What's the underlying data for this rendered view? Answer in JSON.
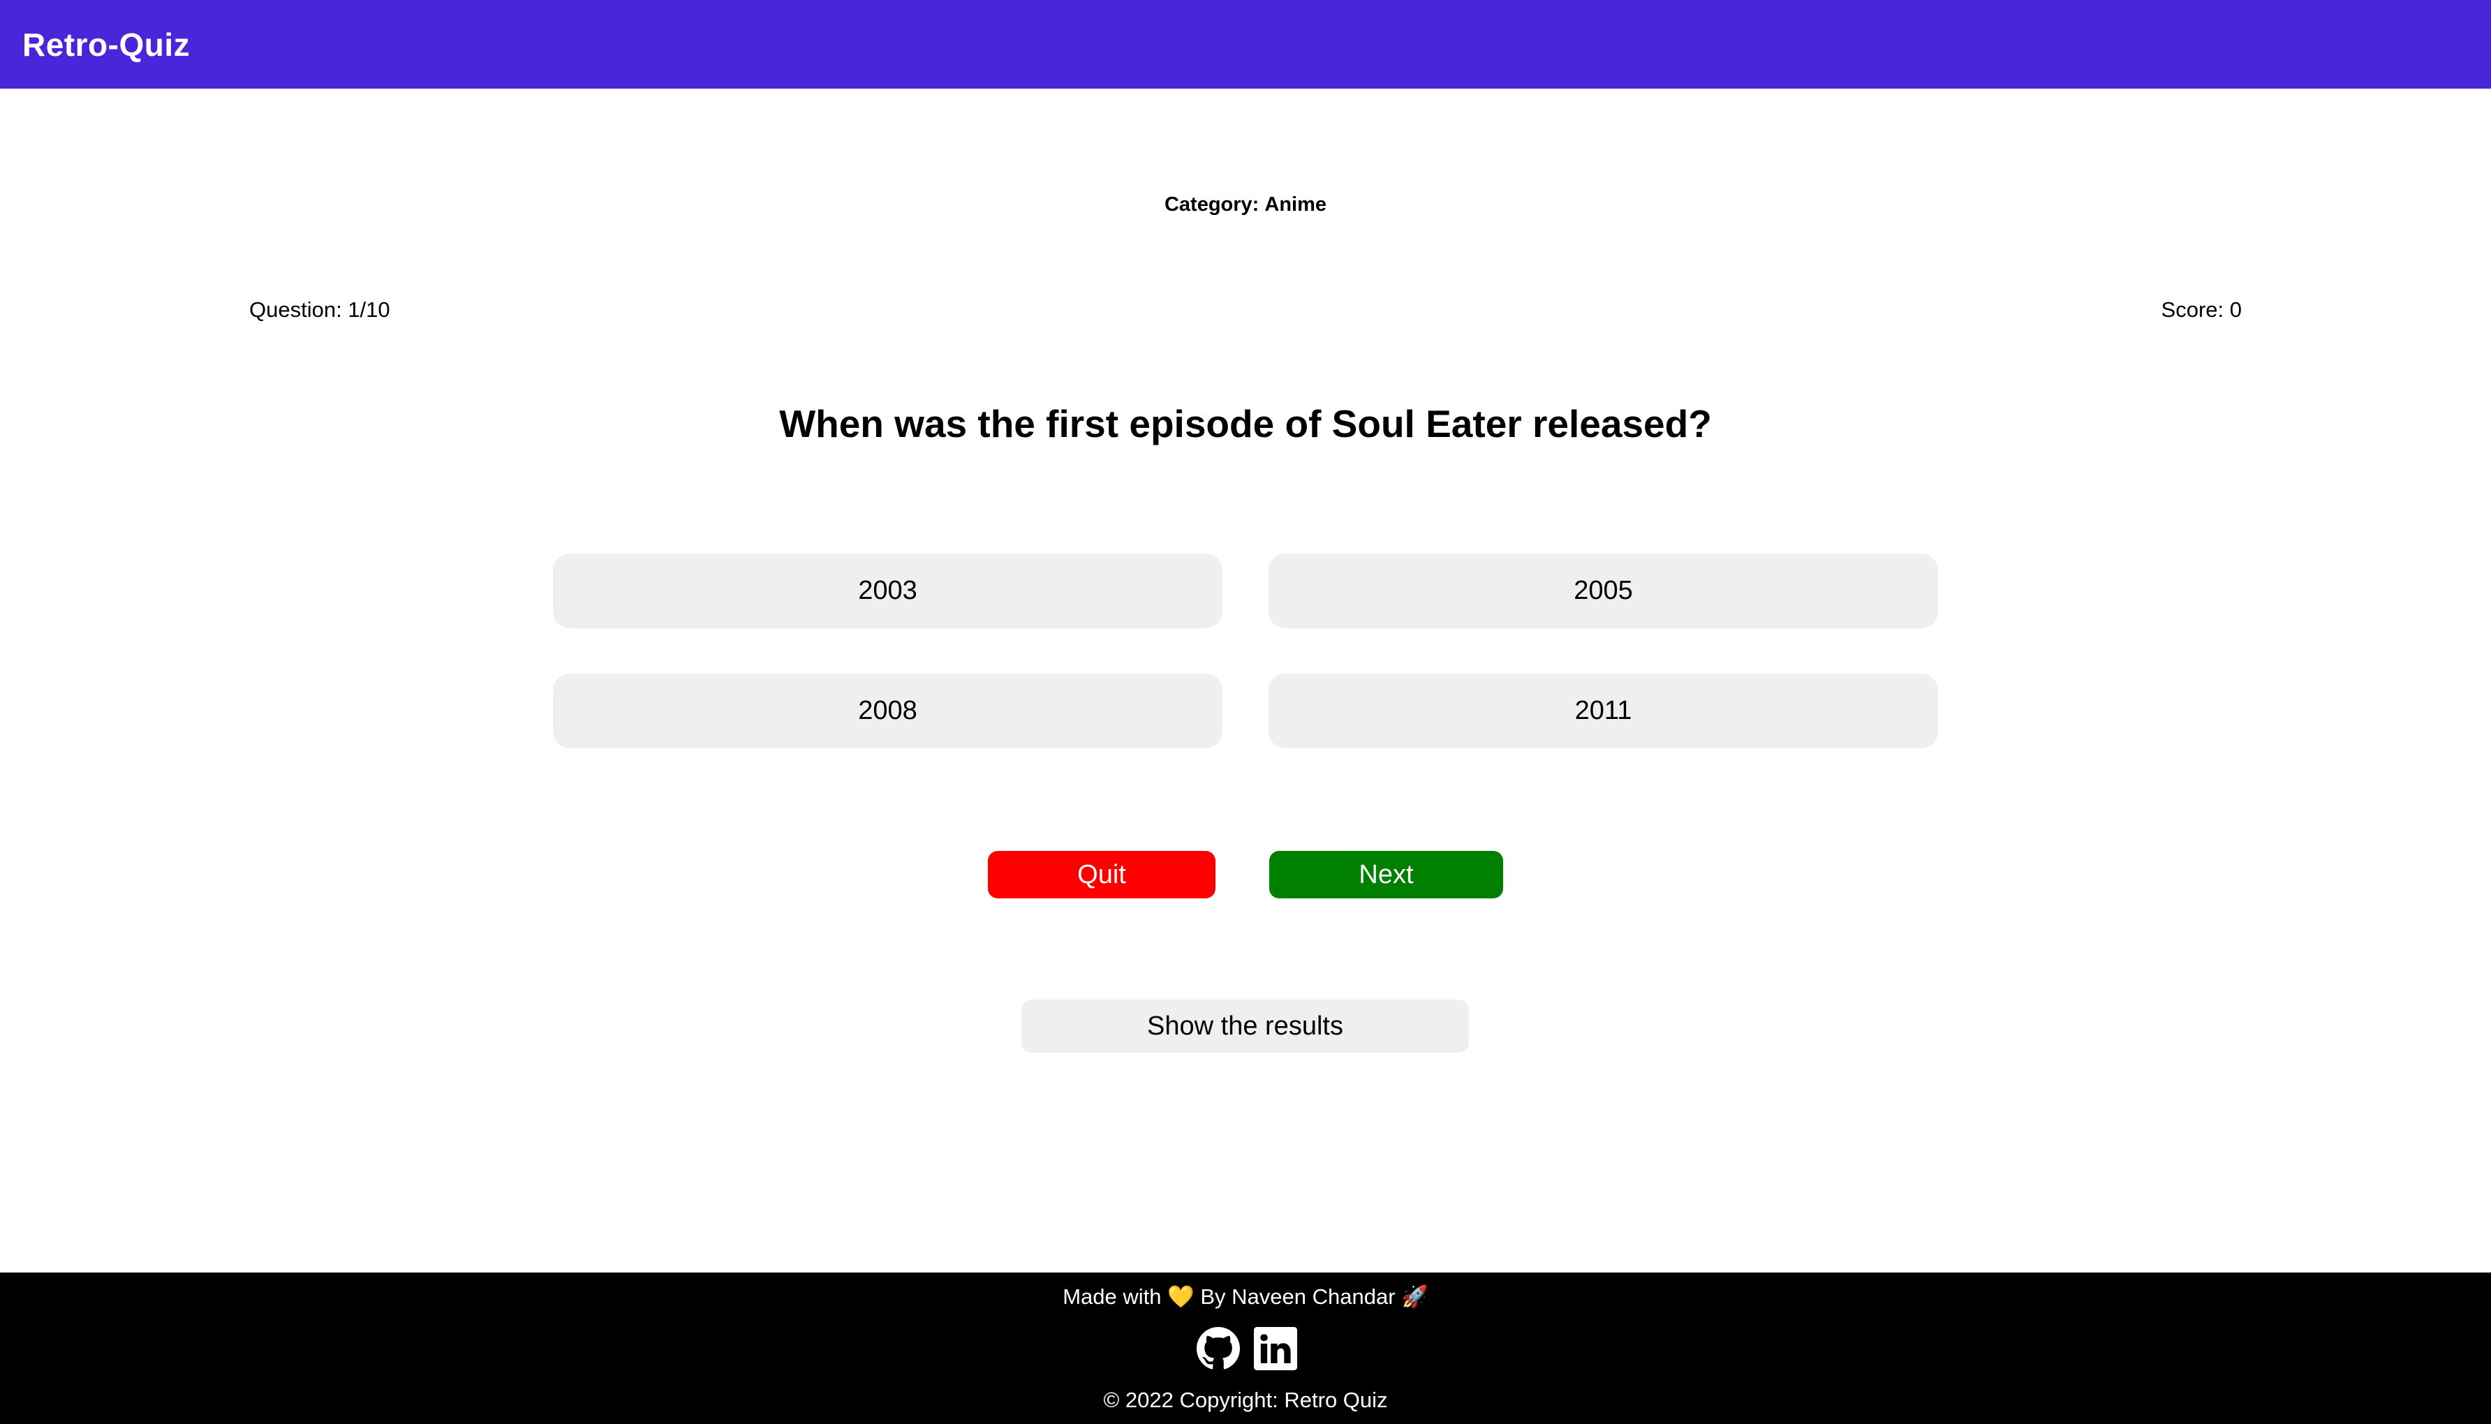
{
  "header": {
    "brand": "Retro-Quiz"
  },
  "quiz": {
    "category_label": "Category:",
    "category_value": "Anime",
    "question_counter": "Question: 1/10",
    "score": "Score: 0",
    "question": "When was the first episode of Soul Eater released?",
    "options": [
      "2003",
      "2005",
      "2008",
      "2011"
    ]
  },
  "actions": {
    "quit_label": "Quit",
    "next_label": "Next",
    "results_label": "Show the results"
  },
  "footer": {
    "made_prefix": "Made with",
    "heart": "💛",
    "made_by": "By Naveen Chandar",
    "rocket": "🚀",
    "icons": [
      "github-icon",
      "linkedin-icon"
    ],
    "copyright": "© 2022 Copyright: Retro Quiz"
  },
  "colors": {
    "navbar": "#4a26db",
    "quit": "#ff0000",
    "next": "#008000",
    "option_bg": "#efefef",
    "footer_bg": "#000000"
  }
}
